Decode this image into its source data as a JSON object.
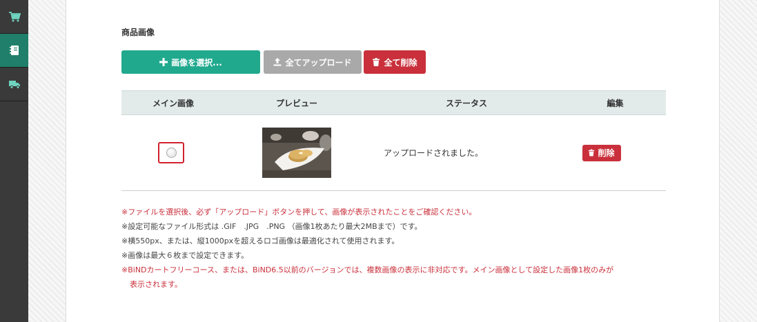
{
  "sidebar": {
    "items": [
      {
        "icon": "cart-icon",
        "active": false
      },
      {
        "icon": "notebook-icon",
        "active": true
      },
      {
        "icon": "truck-icon",
        "active": false
      }
    ]
  },
  "section": {
    "title": "商品画像"
  },
  "toolbar": {
    "select_label": "画像を選択...",
    "upload_all_label": "全てアップロード",
    "delete_all_label": "全て削除"
  },
  "table": {
    "headers": {
      "main": "メイン画像",
      "preview": "プレビュー",
      "status": "ステータス",
      "edit": "編集"
    },
    "rows": [
      {
        "main_selected": false,
        "preview_image": "pancakes-plate",
        "status": "アップロードされました。",
        "delete_label": "削除"
      }
    ]
  },
  "notes": [
    "※ファイルを選択後、必ず「アップロード」ボタンを押して、画像が表示されたことをご確認ください。",
    "※設定可能なファイル形式は .GIF　.JPG　.PNG （画像1枚あたり最大2MBまで）です。",
    "※横550px、または、縦1000pxを超えるロゴ画像は最適化されて使用されます。",
    "※画像は最大６枚まで設定できます。",
    "※BiNDカートフリーコース、または、BiND6.5以前のバージョンでは、複数画像の表示に非対応です。メイン画像として設定した画像1枚のみが",
    "表示されます。"
  ],
  "colors": {
    "accent": "#21a98e",
    "danger": "#c9303b",
    "disabled": "#a9a9a9",
    "sidebar_bg": "#3a3a3a",
    "sidebar_active": "#1f7f6b"
  }
}
